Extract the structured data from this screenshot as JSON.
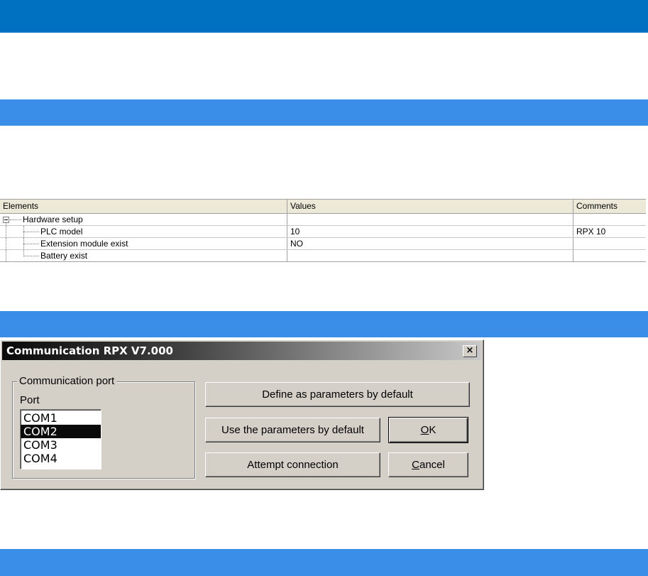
{
  "grid": {
    "headers": {
      "elements": "Elements",
      "values": "Values",
      "comments": "Comments"
    },
    "root": {
      "label": "Hardware setup",
      "value": "",
      "comment": ""
    },
    "rows": [
      {
        "label": "PLC model",
        "value": "10",
        "comment": "RPX 10"
      },
      {
        "label": "Extension module exist",
        "value": "NO",
        "comment": ""
      },
      {
        "label": "Battery exist",
        "value": "",
        "comment": ""
      }
    ]
  },
  "dialog": {
    "title": "Communication RPX V7.000",
    "close_glyph": "×",
    "group_label": "Communication port",
    "port_label": "Port",
    "ports": [
      "COM1",
      "COM2",
      "COM3",
      "COM4"
    ],
    "selected_port": "COM2",
    "buttons": {
      "define_default": "Define as parameters by default",
      "use_default": "Use the parameters by default",
      "ok_mnemonic": "O",
      "ok_rest": "K",
      "attempt": "Attempt connection",
      "cancel_mnemonic": "C",
      "cancel_rest": "ancel"
    }
  },
  "colors": {
    "top_band": "#0070c0",
    "section_band": "#3b8ee8",
    "dialog_face": "#d4d0c8"
  }
}
